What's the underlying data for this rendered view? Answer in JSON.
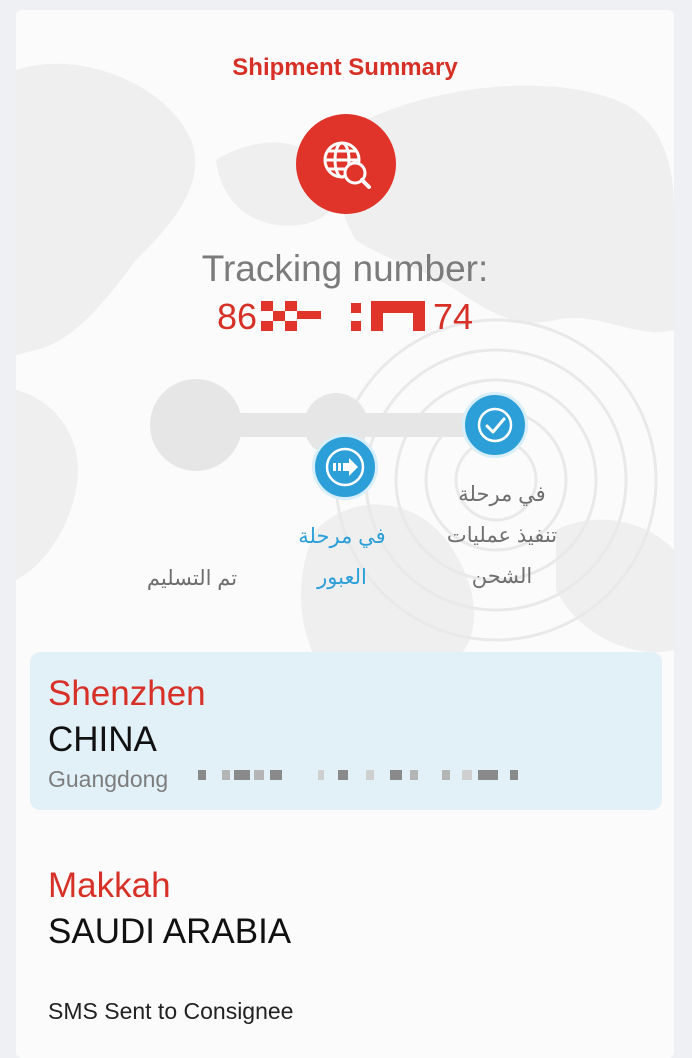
{
  "header": {
    "title": "Shipment Summary"
  },
  "tracking": {
    "label": "Tracking number:",
    "prefix": "86",
    "suffix": "74"
  },
  "steps": [
    {
      "label": "في مرحلة\nتنفيذ عمليات\nالشحن",
      "state": "completed",
      "icon": "check-icon"
    },
    {
      "label": "في مرحلة\nالعبور",
      "state": "current",
      "icon": "arrow-right-icon"
    },
    {
      "label": "تم التسليم",
      "state": "pending",
      "icon": "none"
    }
  ],
  "origin": {
    "city": "Shenzhen",
    "country": "CHINA",
    "region": "Guangdong"
  },
  "destination": {
    "city": "Makkah",
    "country": "SAUDI ARABIA"
  },
  "status": {
    "latest": "SMS Sent to Consignee"
  },
  "colors": {
    "accent_red": "#d63027",
    "step_blue": "#2c9fd9",
    "origin_bg": "#e2f1f8"
  }
}
